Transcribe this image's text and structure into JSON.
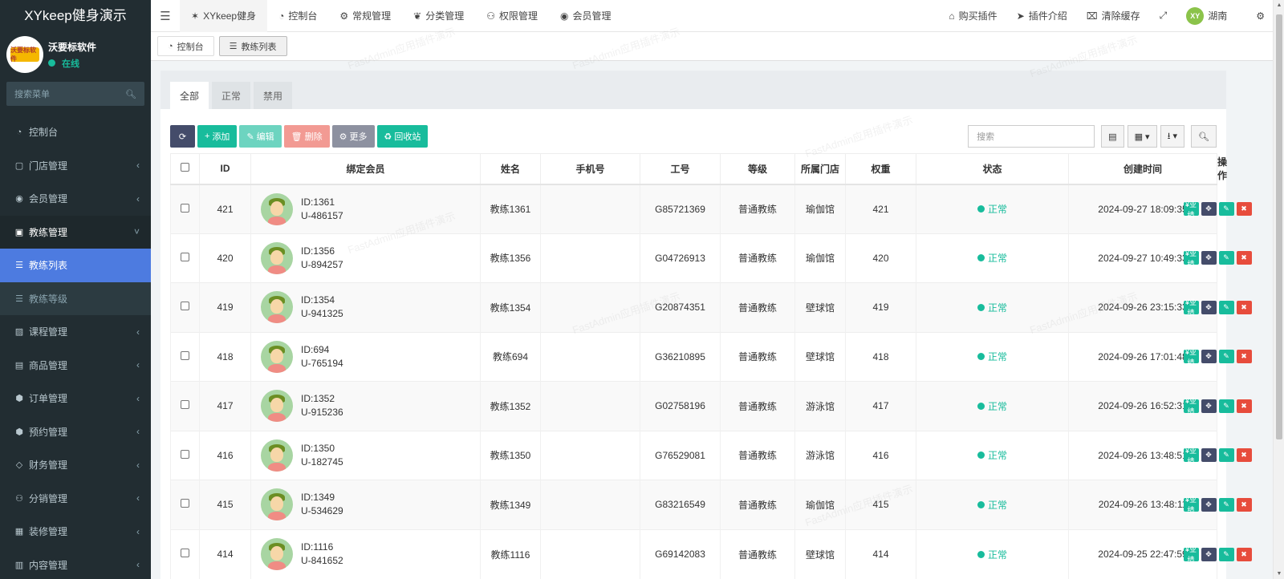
{
  "app": {
    "title": "XYkeep健身演示"
  },
  "user": {
    "name": "沃要标软件",
    "status": "在线",
    "logo_text": "沃要标软件"
  },
  "sidebar": {
    "search_placeholder": "搜索菜单",
    "items": [
      {
        "label": "控制台",
        "icon": "dashboard-icon",
        "has_children": false
      },
      {
        "label": "门店管理",
        "icon": "store-icon",
        "has_children": true
      },
      {
        "label": "会员管理",
        "icon": "user-circle-icon",
        "has_children": true
      },
      {
        "label": "教练管理",
        "icon": "coach-icon",
        "has_children": true,
        "expanded": true
      },
      {
        "label": "教练列表",
        "icon": "list-icon",
        "child": true,
        "active": true
      },
      {
        "label": "教练等级",
        "icon": "list-icon",
        "child": true
      },
      {
        "label": "课程管理",
        "icon": "course-icon",
        "has_children": true
      },
      {
        "label": "商品管理",
        "icon": "goods-icon",
        "has_children": true
      },
      {
        "label": "订单管理",
        "icon": "order-icon",
        "has_children": true
      },
      {
        "label": "预约管理",
        "icon": "booking-icon",
        "has_children": true
      },
      {
        "label": "财务管理",
        "icon": "diamond-icon",
        "has_children": true
      },
      {
        "label": "分销管理",
        "icon": "users-icon",
        "has_children": true
      },
      {
        "label": "装修管理",
        "icon": "decor-icon",
        "has_children": true
      },
      {
        "label": "内容管理",
        "icon": "content-icon",
        "has_children": true
      }
    ]
  },
  "topnav": {
    "items": [
      {
        "label": "XYkeep健身",
        "icon": "pin-icon"
      },
      {
        "label": "控制台",
        "icon": "dashboard-icon"
      },
      {
        "label": "常规管理",
        "icon": "cogs-icon"
      },
      {
        "label": "分类管理",
        "icon": "leaf-icon"
      },
      {
        "label": "权限管理",
        "icon": "users-icon"
      },
      {
        "label": "会员管理",
        "icon": "user-circle-icon"
      }
    ],
    "right": [
      {
        "label": "购买插件",
        "icon": "home-icon"
      },
      {
        "label": "插件介绍",
        "icon": "rocket-icon"
      },
      {
        "label": "清除缓存",
        "icon": "trash-icon"
      }
    ],
    "city": "湖南",
    "city_avatar": "XY"
  },
  "page_tabs": [
    {
      "label": "控制台",
      "icon": "dashboard-icon"
    },
    {
      "label": "教练列表",
      "icon": "list-icon"
    }
  ],
  "filter_tabs": [
    "全部",
    "正常",
    "禁用"
  ],
  "toolbar": {
    "add": "添加",
    "edit": "编辑",
    "delete": "删除",
    "more": "更多",
    "recycle": "回收站",
    "search_placeholder": "搜索"
  },
  "table": {
    "columns": [
      "ID",
      "绑定会员",
      "姓名",
      "手机号",
      "工号",
      "等级",
      "所属门店",
      "权重",
      "状态",
      "创建时间",
      "操作"
    ],
    "rows": [
      {
        "id": "421",
        "member_id": "ID:1361",
        "member_code": "U-486157",
        "name": "教练1361",
        "phone": "",
        "job_no": "G85721369",
        "level": "普通教练",
        "store": "瑜伽馆",
        "weight": "421",
        "status": "正常",
        "created": "2024-09-27 18:09:35"
      },
      {
        "id": "420",
        "member_id": "ID:1356",
        "member_code": "U-894257",
        "name": "教练1356",
        "phone": "",
        "job_no": "G04726913",
        "level": "普通教练",
        "store": "瑜伽馆",
        "weight": "420",
        "status": "正常",
        "created": "2024-09-27 10:49:33"
      },
      {
        "id": "419",
        "member_id": "ID:1354",
        "member_code": "U-941325",
        "name": "教练1354",
        "phone": "",
        "job_no": "G20874351",
        "level": "普通教练",
        "store": "壁球馆",
        "weight": "419",
        "status": "正常",
        "created": "2024-09-26 23:15:33"
      },
      {
        "id": "418",
        "member_id": "ID:694",
        "member_code": "U-765194",
        "name": "教练694",
        "phone": "",
        "job_no": "G36210895",
        "level": "普通教练",
        "store": "壁球馆",
        "weight": "418",
        "status": "正常",
        "created": "2024-09-26 17:01:48"
      },
      {
        "id": "417",
        "member_id": "ID:1352",
        "member_code": "U-915236",
        "name": "教练1352",
        "phone": "",
        "job_no": "G02758196",
        "level": "普通教练",
        "store": "游泳馆",
        "weight": "417",
        "status": "正常",
        "created": "2024-09-26 16:52:31"
      },
      {
        "id": "416",
        "member_id": "ID:1350",
        "member_code": "U-182745",
        "name": "教练1350",
        "phone": "",
        "job_no": "G76529081",
        "level": "普通教练",
        "store": "游泳馆",
        "weight": "416",
        "status": "正常",
        "created": "2024-09-26 13:48:51"
      },
      {
        "id": "415",
        "member_id": "ID:1349",
        "member_code": "U-534629",
        "name": "教练1349",
        "phone": "",
        "job_no": "G83216549",
        "level": "普通教练",
        "store": "瑜伽馆",
        "weight": "415",
        "status": "正常",
        "created": "2024-09-26 13:48:11"
      },
      {
        "id": "414",
        "member_id": "ID:1116",
        "member_code": "U-841652",
        "name": "教练1116",
        "phone": "",
        "job_no": "G69142083",
        "level": "普通教练",
        "store": "壁球馆",
        "weight": "414",
        "status": "正常",
        "created": "2024-09-25 22:47:59"
      }
    ],
    "op_perf_label": "¥业绩"
  },
  "watermark": "FastAdmin应用插件演示",
  "colors": {
    "accent": "#18bc9c",
    "sidebar": "#222d32",
    "active": "#4d7be0",
    "danger": "#e74c3c"
  }
}
